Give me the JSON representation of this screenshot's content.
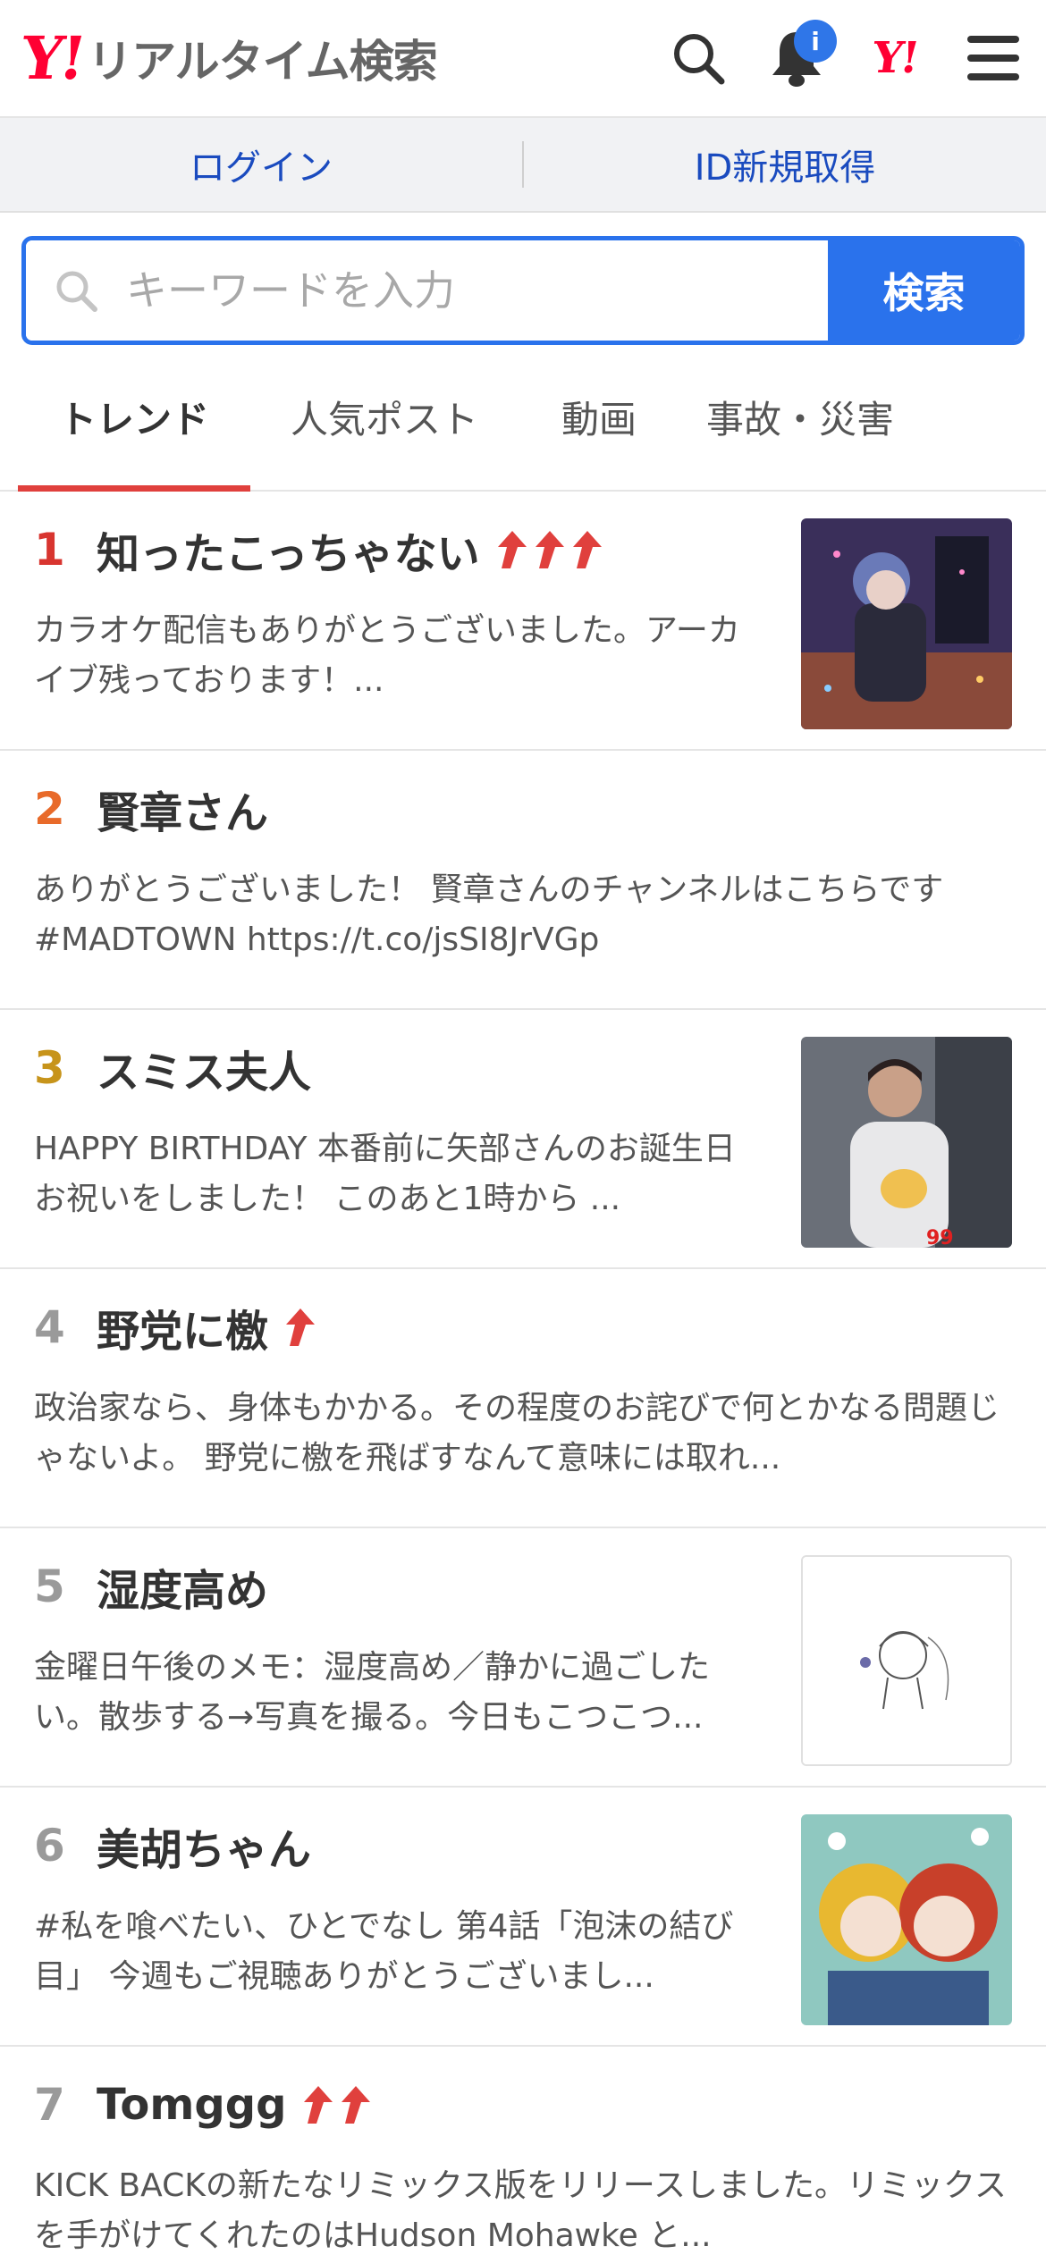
{
  "header": {
    "logo_mark": "Y!",
    "logo_text": "リアルタイム検索",
    "search_icon": "search-icon",
    "bell_icon": "bell-icon",
    "notification_badge": "i",
    "yahoo_small_logo": "Y!",
    "menu_icon": "hamburger-menu-icon"
  },
  "login_bar": {
    "login_label": "ログイン",
    "register_label": "ID新規取得"
  },
  "search": {
    "placeholder": "キーワードを入力",
    "button_label": "検索"
  },
  "tabs": [
    {
      "label": "トレンド",
      "active": true
    },
    {
      "label": "人気ポスト",
      "active": false
    },
    {
      "label": "動画",
      "active": false
    },
    {
      "label": "事故・災害",
      "active": false
    }
  ],
  "trends": [
    {
      "rank": "1",
      "title": "知ったこっちゃない",
      "rise_arrows": 3,
      "description": "カラオケ配信もありがとうございました。アーカイブ残っております！...",
      "thumbnail": "anime-illustration",
      "rank_color": "#d8352f"
    },
    {
      "rank": "2",
      "title": "賢章さん",
      "rise_arrows": 0,
      "description": "ありがとうございました！ 賢章さんのチャンネルはこちらです #MADTOWN https://t.co/jsSI8JrVGp",
      "thumbnail": null,
      "rank_color": "#e86a2a"
    },
    {
      "rank": "3",
      "title": "スミス夫人",
      "rise_arrows": 0,
      "description": "HAPPY BIRTHDAY 本番前に矢部さんのお誕生日お祝いをしました！ このあと1時から ...",
      "thumbnail": "person-photo",
      "rank_color": "#c7941b"
    },
    {
      "rank": "4",
      "title": "野党に檄",
      "rise_arrows": 1,
      "description": "政治家なら、身体もかかる。その程度のお詫びで何とかなる問題じゃないよ。 野党に檄を飛ばすなんて意味には取れ...",
      "thumbnail": null,
      "rank_color": "#9a9a9a"
    },
    {
      "rank": "5",
      "title": "湿度高め",
      "rise_arrows": 0,
      "description": "金曜日午後のメモ：湿度高め／静かに過ごしたい。散歩する→写真を撮る。今日もこつこつ...",
      "thumbnail": "sketch-drawing",
      "rank_color": "#9a9a9a"
    },
    {
      "rank": "6",
      "title": "美胡ちゃん",
      "rise_arrows": 0,
      "description": "#私を喰べたい、ひとでなし 第4話「泡沫の結び目」 今週もご視聴ありがとうございまし...",
      "thumbnail": "anime-duo",
      "rank_color": "#9a9a9a"
    },
    {
      "rank": "7",
      "title": "Tomggg",
      "rise_arrows": 2,
      "description": "KICK BACKの新たなリミックス版をリリースしました。リミックスを手がけてくれたのはHudson Mohawke と...",
      "thumbnail": null,
      "rank_color": "#9a9a9a"
    }
  ],
  "colors": {
    "brand_red": "#ff0033",
    "accent_blue": "#2a72ec",
    "link_blue": "#1a4bbf",
    "tab_underline": "#e0403d",
    "arrow_red": "#e0403d"
  }
}
